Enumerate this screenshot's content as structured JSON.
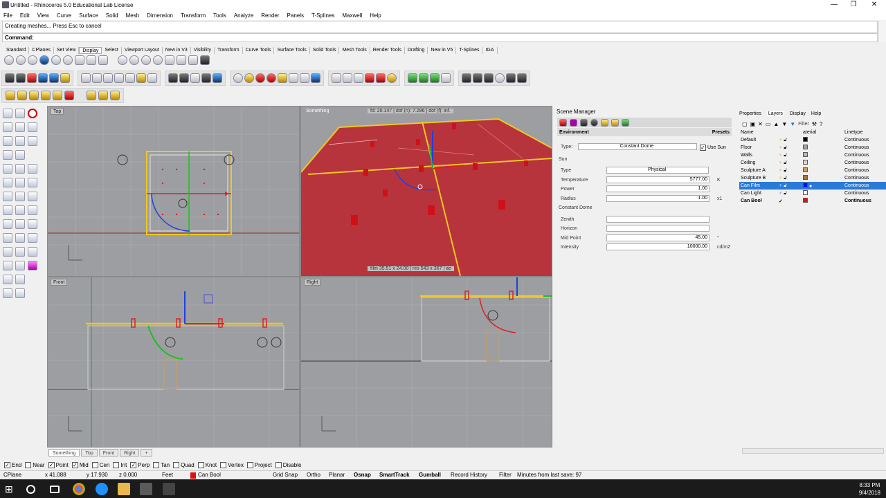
{
  "app": {
    "title": "Untitled - Rhinoceros 5.0 Educational Lab License"
  },
  "window_controls": {
    "minimize": "—",
    "maximize": "❐",
    "close": "✕"
  },
  "menu": [
    "File",
    "Edit",
    "View",
    "Curve",
    "Surface",
    "Solid",
    "Mesh",
    "Dimension",
    "Transform",
    "Tools",
    "Analyze",
    "Render",
    "Panels",
    "T-Splines",
    "Maxwell",
    "Help"
  ],
  "command": {
    "history": "Creating meshes... Press Esc to cancel",
    "prompt": "Command:"
  },
  "toolbar_tabs": [
    "Standard",
    "CPlanes",
    "Set View",
    "Display",
    "Select",
    "Viewport Layout",
    "New in V3",
    "Visibility",
    "Transform",
    "Curve Tools",
    "Surface Tools",
    "Solid Tools",
    "Mesh Tools",
    "Render Tools",
    "Drafting",
    "New in V5",
    "T-Splines",
    "IGA"
  ],
  "toolbar_active_tab": "Display",
  "viewports": {
    "top": {
      "title": "Top"
    },
    "perspective": {
      "title": "Something",
      "hud_top": "fd: 20.147  |  dof (n): 7.286  |  dof (f): inf.",
      "hud_bottom": "film 35.51 x 24.00  |  res 543 x 367  |  ae"
    },
    "front": {
      "title": "Front"
    },
    "right": {
      "title": "Right"
    }
  },
  "viewport_tabs": [
    "Something",
    "Top",
    "Front",
    "Right",
    "+"
  ],
  "scene_manager": {
    "title": "Scene Manager",
    "section": "Environment",
    "presets": "Presets",
    "type_label": "Type:",
    "type_value": "Constant Dome",
    "use_sun": "Use Sun",
    "sun_header": "Sun",
    "sun_type_label": "Type",
    "sun_type_value": "Physical",
    "temperature_label": "Temperature",
    "temperature_value": "5777.00",
    "temperature_unit": "K",
    "power_label": "Power",
    "power_value": "1.00",
    "radius_label": "Radius",
    "radius_value": "1.00",
    "radius_unit": "x1",
    "dome_header": "Constant Dome",
    "zenith_label": "Zenith",
    "horizon_label": "Horizon",
    "midpoint_label": "Mid Point",
    "midpoint_value": "45.00",
    "midpoint_unit": "°",
    "intensity_label": "Intensity",
    "intensity_value": "10000.00",
    "intensity_unit": "cd/m2"
  },
  "panel_tabs": [
    "Properties",
    "Layers",
    "Display",
    "Help"
  ],
  "layers": {
    "tooltip": "Filter",
    "columns": {
      "name": "Name",
      "material": "aterial",
      "linetype": "Linetype"
    },
    "rows": [
      {
        "name": "Default",
        "color": "#000000",
        "linetype": "Continuous"
      },
      {
        "name": "Floor",
        "color": "#9aa0a6",
        "linetype": "Continuous"
      },
      {
        "name": "Walls",
        "color": "#b8b8b8",
        "linetype": "Continuous"
      },
      {
        "name": "Ceiling",
        "color": "#d8d8d8",
        "linetype": "Continuous"
      },
      {
        "name": "Sculpture A",
        "color": "#c8a060",
        "linetype": "Continuous"
      },
      {
        "name": "Sculpture B",
        "color": "#a07840",
        "linetype": "Continuous"
      },
      {
        "name": "Can Film",
        "color": "#0000ff",
        "linetype": "Continuous",
        "selected": true
      },
      {
        "name": "Can Light",
        "color": "#ffffff",
        "linetype": "Continuous"
      },
      {
        "name": "Can Bool",
        "color": "#e01010",
        "linetype": "Continuous",
        "current": true
      }
    ],
    "current_mark": "✓"
  },
  "osnaps": [
    {
      "label": "End",
      "checked": true
    },
    {
      "label": "Near",
      "checked": false
    },
    {
      "label": "Point",
      "checked": true
    },
    {
      "label": "Mid",
      "checked": true
    },
    {
      "label": "Cen",
      "checked": false
    },
    {
      "label": "Int",
      "checked": false
    },
    {
      "label": "Perp",
      "checked": true
    },
    {
      "label": "Tan",
      "checked": false
    },
    {
      "label": "Quad",
      "checked": false
    },
    {
      "label": "Knot",
      "checked": false
    },
    {
      "label": "Vertex",
      "checked": false
    },
    {
      "label": "Project",
      "checked": false
    },
    {
      "label": "Disable",
      "checked": false
    }
  ],
  "status": {
    "cplane": "CPlane",
    "x": "x 41.088",
    "y": "y 17.930",
    "z": "z 0.000",
    "units": "Feet",
    "layer": "Can Bool",
    "layer_color": "#e01010",
    "grid_snap": "Grid Snap",
    "ortho": "Ortho",
    "planar": "Planar",
    "osnap": "Osnap",
    "smarttrack": "SmartTrack",
    "gumball": "Gumball",
    "record_history": "Record History",
    "filter": "Filter",
    "last_save": "Minutes from last save: 97"
  },
  "taskbar": {
    "time": "8:33 PM",
    "date": "9/4/2018"
  },
  "colors": {
    "floor_red": "#b8343c",
    "wire_yellow": "#f0c820",
    "axis_red": "#e02020",
    "axis_green": "#20c020",
    "axis_blue": "#2040e0"
  }
}
